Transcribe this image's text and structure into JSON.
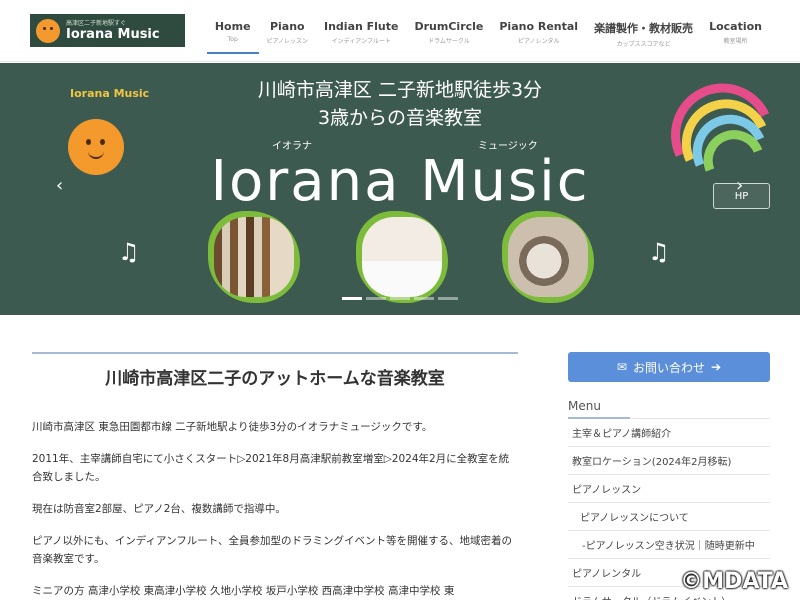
{
  "header": {
    "logo": {
      "sub": "高津区二子新地駅すぐ",
      "name": "Iorana Music"
    },
    "nav": [
      {
        "label": "Home",
        "sub": "Top"
      },
      {
        "label": "Piano",
        "sub": "ピアノレッスン"
      },
      {
        "label": "Indian Flute",
        "sub": "インディアンフルート"
      },
      {
        "label": "DrumCircle",
        "sub": "ドラムサークル"
      },
      {
        "label": "Piano Rental",
        "sub": "ピアノレンタル"
      },
      {
        "label": "楽譜製作・教材販売",
        "sub": "カップススコアなど"
      },
      {
        "label": "Location",
        "sub": "教室場所"
      }
    ]
  },
  "hero": {
    "line1": "川崎市高津区 二子新地駅徒歩3分",
    "line2": "3歳からの音楽教室",
    "ruby_left": "イオラナ",
    "ruby_right": "ミュージック",
    "title": "Iorana Music",
    "logo_text": "Iorana Music",
    "hp_label": "HP",
    "prev": "‹",
    "next": "›",
    "slide_index": 1,
    "slide_count": 5
  },
  "main": {
    "heading": "川崎市高津区二子のアットホームな音楽教室",
    "paragraphs": [
      "川崎市高津区 東急田園都市線 二子新地駅より徒歩3分のイオラナミュージックです。",
      "2011年、主宰講師自宅にて小さくスタート▷2021年8月高津駅前教室増室▷2024年2月に全教室を統合致しました。",
      "現在は防音室2部屋、ピアノ2台、複数講師で指導中。",
      "ピアノ以外にも、インディアンフルート、全員参加型のドラミングイベント等を開催する、地域密着の音楽教室です。",
      "ミニアの方 高津小学校 東高津小学校 久地小学校 坂戸小学校 西高津中学校 高津中学校 東"
    ]
  },
  "sidebar": {
    "contact_label": "お問い合わせ",
    "menu_title": "Menu",
    "items": [
      {
        "label": "主宰＆ピアノ講師紹介",
        "level": 0
      },
      {
        "label": "教室ロケーション(2024年2月移転)",
        "level": 0
      },
      {
        "label": "ピアノレッスン",
        "level": 0
      },
      {
        "label": "ピアノレッスンについて",
        "level": 1
      },
      {
        "label": "-ピアノレッスン空き状況｜随時更新中",
        "level": 2
      },
      {
        "label": "ピアノレンタル",
        "level": 0
      },
      {
        "label": "ドラムサークル（ドラムイベント）",
        "level": 0
      }
    ]
  },
  "watermark": "©MDATA",
  "colors": {
    "hero_bg": "#3d5a50",
    "accent": "#5b8fd9",
    "rule": "#a6b9d8"
  }
}
